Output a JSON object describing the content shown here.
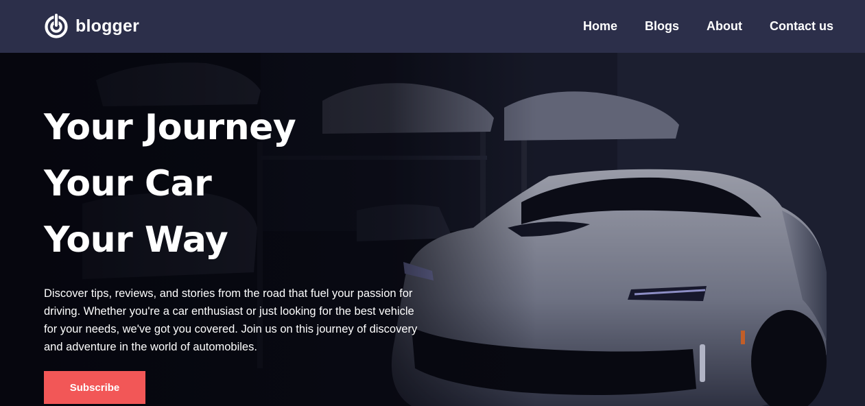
{
  "brand": {
    "name": "blogger",
    "icon": "blogger-power-icon"
  },
  "nav": {
    "items": [
      {
        "label": "Home"
      },
      {
        "label": "Blogs"
      },
      {
        "label": "About"
      },
      {
        "label": "Contact us"
      }
    ]
  },
  "hero": {
    "headline_lines": [
      "Your Journey",
      "Your Car",
      "Your Way"
    ],
    "description": "Discover tips, reviews, and stories from the road that fuel your passion for driving. Whether you're a car enthusiast or just looking for the best vehicle for your needs, we've got you covered. Join us on this journey of discovery and adventure in the world of automobiles.",
    "cta_label": "Subscribe",
    "background_image": "sports-car-garage-photo"
  },
  "colors": {
    "navbar": "#2c2f4a",
    "accent": "#f25757",
    "text": "#ffffff"
  }
}
